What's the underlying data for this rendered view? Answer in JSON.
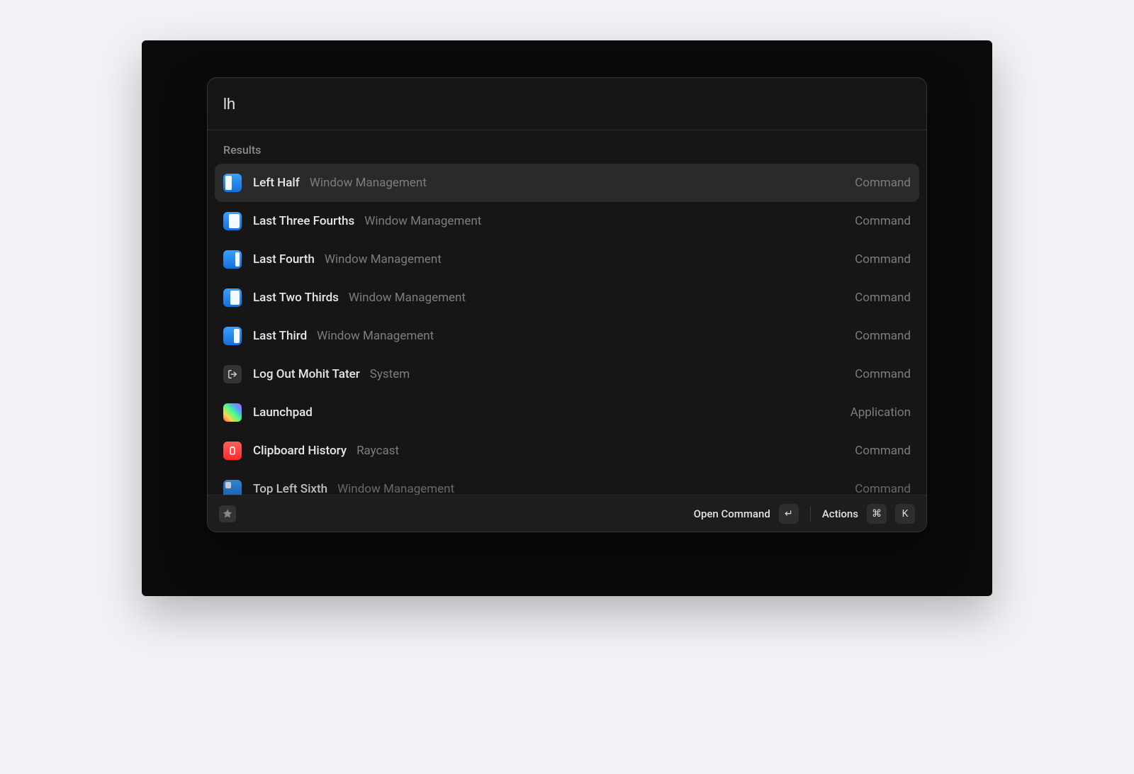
{
  "search": {
    "value": "lh"
  },
  "sectionHeader": "Results",
  "results": [
    {
      "title": "Left Half",
      "subtitle": "Window Management",
      "type": "Command",
      "icon": "wm-left-half",
      "selected": true
    },
    {
      "title": "Last Three Fourths",
      "subtitle": "Window Management",
      "type": "Command",
      "icon": "wm-last-3-4",
      "selected": false
    },
    {
      "title": "Last Fourth",
      "subtitle": "Window Management",
      "type": "Command",
      "icon": "wm-last-fourth",
      "selected": false
    },
    {
      "title": "Last Two Thirds",
      "subtitle": "Window Management",
      "type": "Command",
      "icon": "wm-last-2-3",
      "selected": false
    },
    {
      "title": "Last Third",
      "subtitle": "Window Management",
      "type": "Command",
      "icon": "wm-last-third",
      "selected": false
    },
    {
      "title": "Log Out Mohit Tater",
      "subtitle": "System",
      "type": "Command",
      "icon": "logout",
      "selected": false
    },
    {
      "title": "Launchpad",
      "subtitle": "",
      "type": "Application",
      "icon": "launchpad",
      "selected": false
    },
    {
      "title": "Clipboard History",
      "subtitle": "Raycast",
      "type": "Command",
      "icon": "clipboard",
      "selected": false
    },
    {
      "title": "Top Left Sixth",
      "subtitle": "Window Management",
      "type": "Command",
      "icon": "wm-top-left-6",
      "selected": false
    }
  ],
  "footer": {
    "primaryAction": "Open Command",
    "primaryKey": "↵",
    "secondaryAction": "Actions",
    "secondaryKeys": [
      "⌘",
      "K"
    ]
  }
}
